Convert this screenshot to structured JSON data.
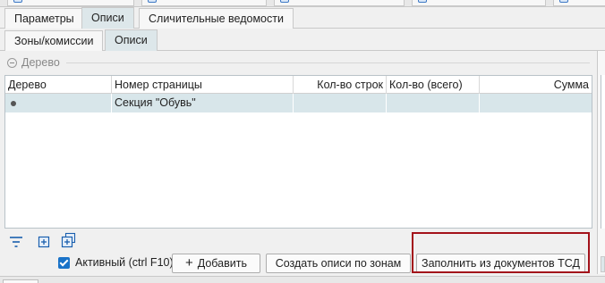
{
  "tabs_main": {
    "items": [
      {
        "label": "Параметры",
        "active": false
      },
      {
        "label": "Описи",
        "active": true
      },
      {
        "label": "Сличительные ведомости",
        "active": false
      }
    ]
  },
  "tabs_sub": {
    "items": [
      {
        "label": "Зоны/комиссии",
        "active": false
      },
      {
        "label": "Описи",
        "active": true
      }
    ]
  },
  "tree_group": {
    "title": "Дерево"
  },
  "grid": {
    "columns": [
      "Дерево",
      "Номер страницы",
      "Кол-во строк",
      "Кол-во (всего)",
      "Сумма"
    ],
    "rows": [
      {
        "tree": "",
        "page": "Секция \"Обувь\"",
        "rows_count": "",
        "qty_total": "",
        "sum": ""
      }
    ]
  },
  "toolbar_icons": [
    "filter-icon",
    "expand-all-icon",
    "collapse-all-icon"
  ],
  "bottom": {
    "active_checkbox": {
      "label": "Активный (ctrl F10)",
      "checked": true
    },
    "add_button": {
      "icon": "plus",
      "label": "Добавить"
    },
    "create_button": {
      "label": "Создать описи по зонам"
    },
    "fill_button": {
      "label": "Заполнить из документов ТСД"
    }
  },
  "colors": {
    "accent": "#1a73c8",
    "selected_row": "#d8e6ea",
    "active_tab": "#dde7ea",
    "highlight_border": "#a3121a"
  }
}
